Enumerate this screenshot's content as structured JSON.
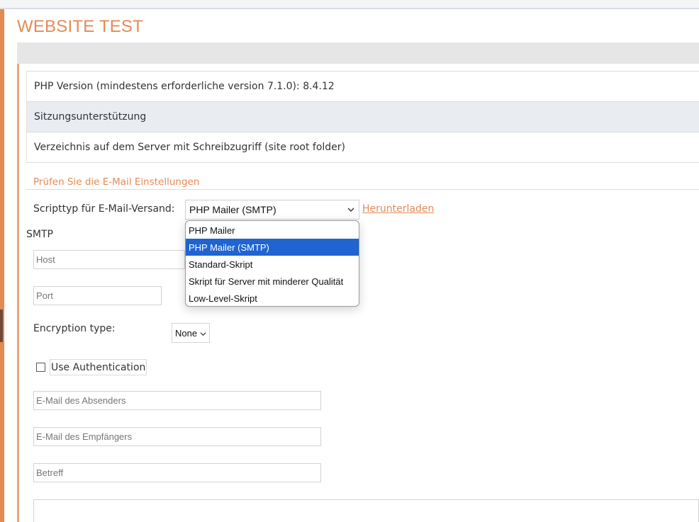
{
  "header": {
    "title": "WEBSITE TEST"
  },
  "requirements": [
    {
      "text": "PHP Version (mindestens erforderliche version 7.1.0): 8.4.12"
    },
    {
      "text": "Sitzungsunterstützung"
    },
    {
      "text": "Verzeichnis auf dem Server mit Schreibzugriff (site root folder)"
    }
  ],
  "email_section": {
    "title": "Prüfen Sie die E-Mail Einstellungen",
    "script_type_label": "Scripttyp für E-Mail-Versand:",
    "script_type_value": "PHP Mailer (SMTP)",
    "download_link": "Herunterladen",
    "dropdown_options": [
      "PHP Mailer",
      "PHP Mailer (SMTP)",
      "Standard-Skript",
      "Skript für Server mit minderer Qualität",
      "Low-Level-Skript"
    ],
    "selected_option_index": 1
  },
  "smtp": {
    "heading": "SMTP",
    "host_placeholder": "Host",
    "port_placeholder": "Port",
    "encryption_label": "Encryption type:",
    "encryption_value": "None",
    "use_auth_label": "Use Authentication",
    "use_auth_checked": false,
    "sender_placeholder": "E-Mail des Absenders",
    "recipient_placeholder": "E-Mail des Empfängers",
    "subject_placeholder": "Betreff"
  },
  "colors": {
    "accent": "#e58a55",
    "selection": "#1f64d1",
    "alt_row": "#e9edf1"
  }
}
